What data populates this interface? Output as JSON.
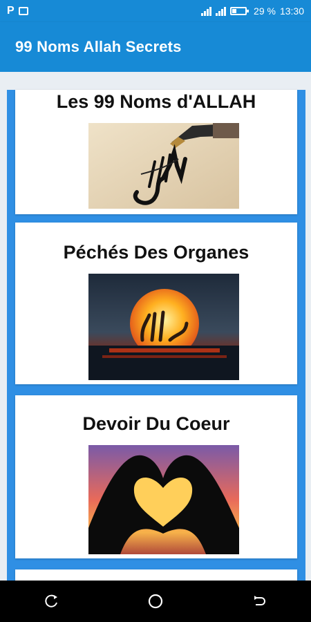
{
  "status_bar": {
    "battery_percent": "29 %",
    "time": "13:30",
    "icons": [
      "p-icon",
      "image-icon",
      "signal-icon",
      "signal-icon",
      "battery-icon"
    ]
  },
  "app_bar": {
    "title": "99 Noms Allah Secrets",
    "color": "#178ad6"
  },
  "cards": [
    {
      "title": "Les 99 Noms d'ALLAH",
      "image": "calligraphy-pen-image"
    },
    {
      "title": "Péchés Des Organes",
      "image": "sunset-calligraphy-image"
    },
    {
      "title": "Devoir Du Coeur",
      "image": "heart-hands-image"
    }
  ],
  "nav_bar": {
    "buttons": [
      "recent-apps-icon",
      "home-icon",
      "back-icon"
    ]
  }
}
